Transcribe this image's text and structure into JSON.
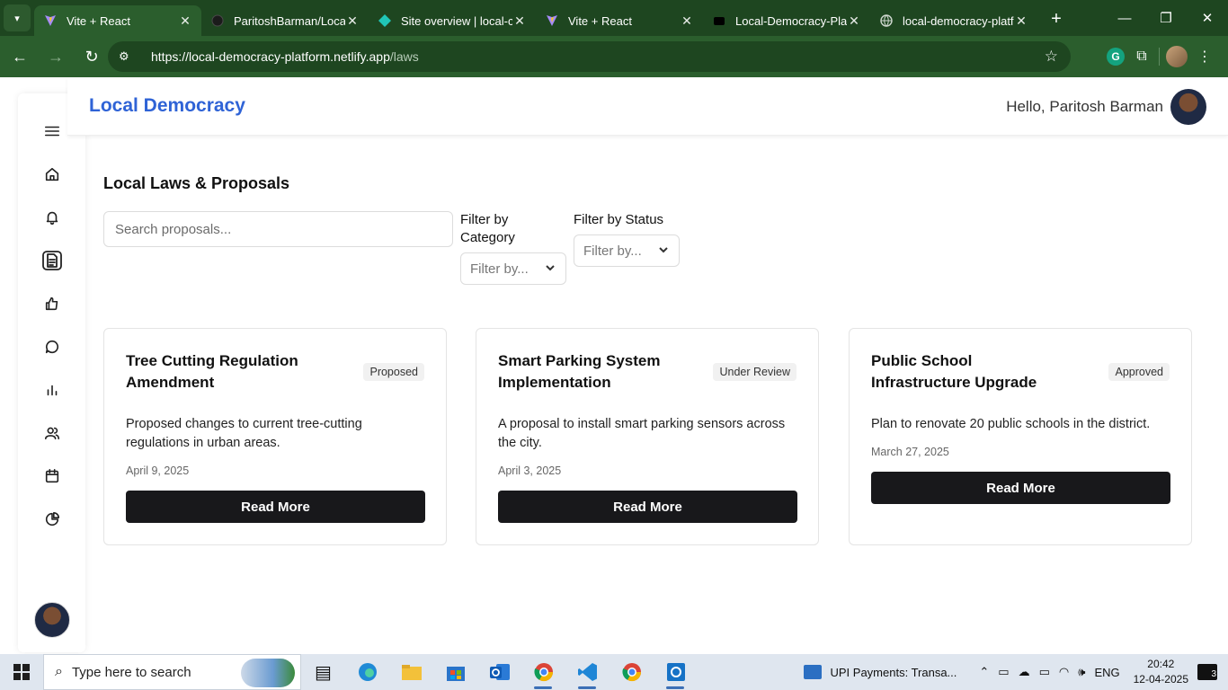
{
  "browser": {
    "tabs": [
      {
        "title": "Vite + React",
        "icon": "vite-icon",
        "active": true
      },
      {
        "title": "ParitoshBarman/Local",
        "icon": "github-icon",
        "active": false
      },
      {
        "title": "Site overview | local-c",
        "icon": "netlify-icon",
        "active": false
      },
      {
        "title": "Vite + React",
        "icon": "vite-icon",
        "active": false
      },
      {
        "title": "Local-Democracy-Pla",
        "icon": "vercel-icon",
        "active": false
      },
      {
        "title": "local-democracy-platf",
        "icon": "globe-icon",
        "active": false
      }
    ],
    "url_host": "https://local-democracy-platform.netlify.app",
    "url_path": "/laws"
  },
  "app": {
    "brand": "Local Democracy",
    "greeting": "Hello, Paritosh Barman",
    "page_title": "Local Laws & Proposals",
    "search_placeholder": "Search proposals...",
    "filter_category_label": "Filter by Category",
    "filter_category_value": "Filter by...",
    "filter_status_label": "Filter by Status",
    "filter_status_value": "Filter by...",
    "sidebar_items": [
      "menu-icon",
      "home-icon",
      "bell-icon",
      "document-icon",
      "thumbs-up-icon",
      "chat-icon",
      "bar-chart-icon",
      "users-icon",
      "calendar-icon",
      "pie-chart-icon"
    ],
    "cards": [
      {
        "title": "Tree Cutting Regulation Amendment",
        "status": "Proposed",
        "description": "Proposed changes to current tree-cutting regulations in urban areas.",
        "date": "April 9, 2025",
        "button": "Read More"
      },
      {
        "title": "Smart Parking System Implementation",
        "status": "Under Review",
        "description": "A proposal to install smart parking sensors across the city.",
        "date": "April 3, 2025",
        "button": "Read More"
      },
      {
        "title": "Public School Infrastructure Upgrade",
        "status": "Approved",
        "description": "Plan to renovate 20 public schools in the district.",
        "date": "March 27, 2025",
        "button": "Read More"
      }
    ]
  },
  "taskbar": {
    "search_placeholder": "Type here to search",
    "notification_app": "UPI Payments: Transa...",
    "language": "ENG",
    "time": "20:42",
    "date": "12-04-2025",
    "notification_count": "3"
  }
}
